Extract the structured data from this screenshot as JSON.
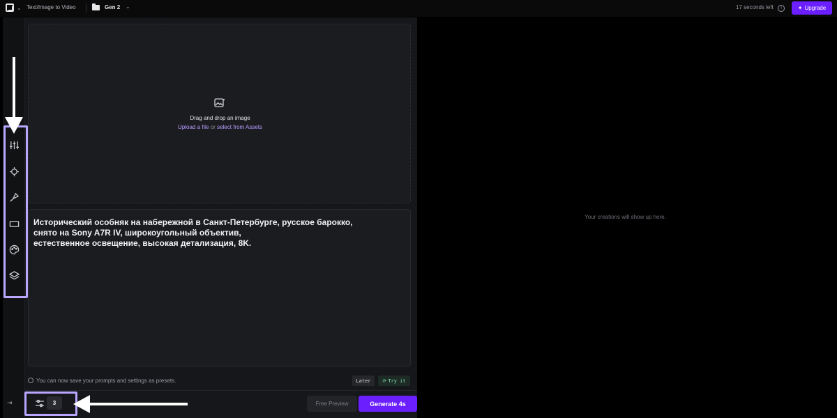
{
  "topbar": {
    "mode_label": "Text/Image to Video",
    "project_label": "Gen 2",
    "time_left": "17 seconds left",
    "upgrade_label": "Upgrade"
  },
  "sidebar": {
    "icons": [
      "sliders-icon",
      "camera-motion-icon",
      "brush-icon",
      "aspect-ratio-icon",
      "palette-icon",
      "layers-icon"
    ]
  },
  "dropzone": {
    "title": "Drag and drop an image",
    "upload_link": "Upload a file",
    "or_text": "or",
    "assets_link": "select from Assets"
  },
  "prompt": {
    "text": "Исторический особняк на набережной в Санкт-Петербурге, русское барокко,\nснято на Sony A7R IV, широкоугольный объектив,\nестественное освещение, высокая детализация, 8K."
  },
  "tip": {
    "text": "You can now save your prompts and settings as presets.",
    "later_label": "Later",
    "try_label": "Try it"
  },
  "footer": {
    "count": "3",
    "free_preview_label": "Free Preview",
    "generate_label": "Generate 4s"
  },
  "results": {
    "empty_message": "Your creations will show up here."
  },
  "colors": {
    "accent": "#6b1fff",
    "highlight": "#b8a6ff",
    "link": "#b79bff"
  }
}
